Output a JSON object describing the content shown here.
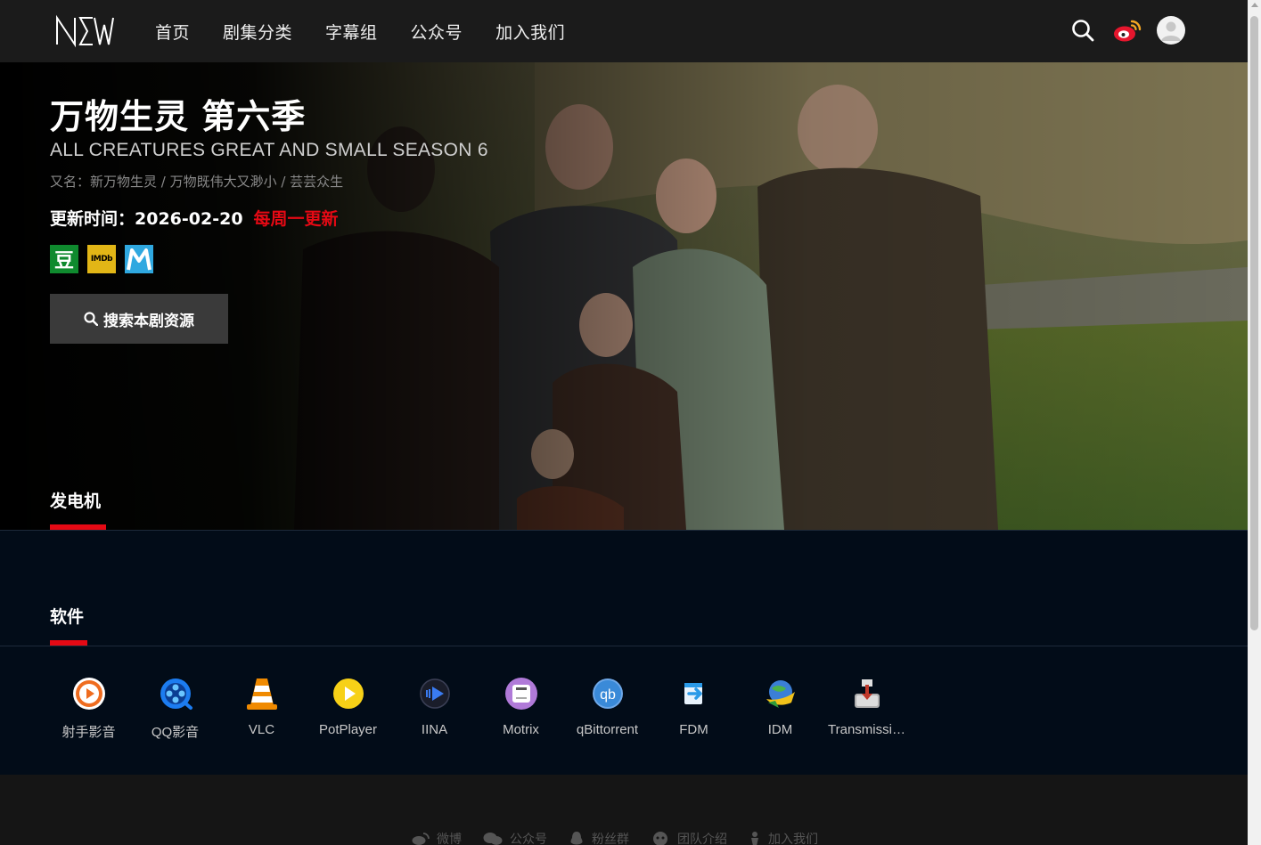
{
  "header": {
    "logo_text": "NEW",
    "nav": [
      "首页",
      "剧集分类",
      "字幕组",
      "公众号",
      "加入我们"
    ],
    "icons": [
      "search-icon",
      "weibo-icon",
      "user-avatar-icon"
    ]
  },
  "show": {
    "title": "万物生灵 第六季",
    "english_title": "ALL CREATURES GREAT AND SMALL SEASON 6",
    "aka": "又名：新万物生灵 / 万物既伟大又渺小 / 芸芸众生",
    "update_label": "更新时间：2026-02-20",
    "update_frequency": "每周一更新",
    "badges": [
      {
        "name": "douban",
        "text": "豆"
      },
      {
        "name": "imdb",
        "text": "IMDb"
      },
      {
        "name": "m",
        "text": "M"
      }
    ],
    "search_button": "搜索本剧资源"
  },
  "sections": {
    "tab1": "发电机",
    "tab2": "软件"
  },
  "apps": [
    {
      "label": "射手影音",
      "icon": "shooter-icon",
      "color": "#ef6c1f"
    },
    {
      "label": "QQ影音",
      "icon": "qq-player-icon",
      "color": "#1c7cf0"
    },
    {
      "label": "VLC",
      "icon": "vlc-cone-icon",
      "color": "#f08a00"
    },
    {
      "label": "PotPlayer",
      "icon": "potplayer-icon",
      "color": "#f7d117"
    },
    {
      "label": "IINA",
      "icon": "iina-icon",
      "color": "#3a7bf0"
    },
    {
      "label": "Motrix",
      "icon": "motrix-icon",
      "color": "#b07ad8"
    },
    {
      "label": "qBittorrent",
      "icon": "qbittorrent-icon",
      "color": "#3a8ad8"
    },
    {
      "label": "FDM",
      "icon": "fdm-icon",
      "color": "#2a9ae8"
    },
    {
      "label": "IDM",
      "icon": "idm-icon",
      "color": "#2f9c3a"
    },
    {
      "label": "Transmissi…",
      "icon": "transmission-icon",
      "color": "#c0392b"
    }
  ],
  "footer": {
    "links": [
      {
        "label": "微博",
        "icon": "weibo-icon"
      },
      {
        "label": "公众号",
        "icon": "wechat-icon"
      },
      {
        "label": "粉丝群",
        "icon": "qq-group-icon"
      },
      {
        "label": "团队介绍",
        "icon": "team-icon"
      },
      {
        "label": "加入我们",
        "icon": "join-icon"
      }
    ]
  },
  "colors": {
    "accent": "#e50914",
    "header_bg": "#1b1b1b",
    "band_bg": "#020c18"
  }
}
